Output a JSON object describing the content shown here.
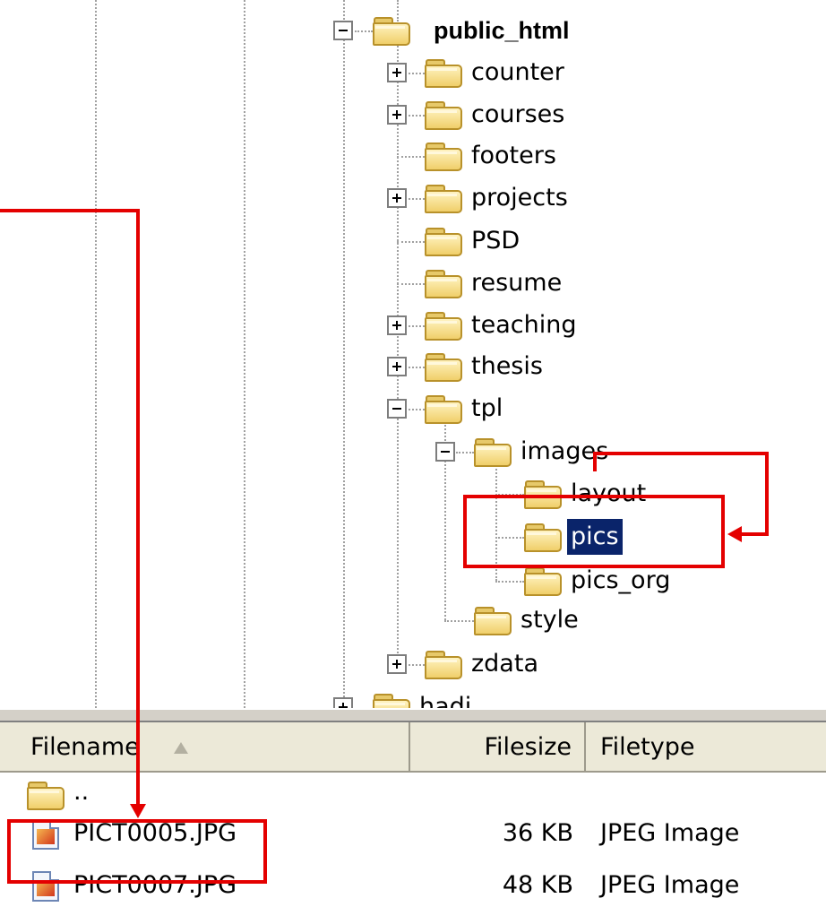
{
  "tree": {
    "nodes": [
      {
        "id": "public_html",
        "label": "public_html",
        "toggle": "minus"
      },
      {
        "id": "counter",
        "label": "counter",
        "toggle": "plus"
      },
      {
        "id": "courses",
        "label": "courses",
        "toggle": "plus"
      },
      {
        "id": "footers",
        "label": "footers",
        "toggle": "none"
      },
      {
        "id": "projects",
        "label": "projects",
        "toggle": "plus"
      },
      {
        "id": "psd",
        "label": "PSD",
        "toggle": "none"
      },
      {
        "id": "resume",
        "label": "resume",
        "toggle": "none"
      },
      {
        "id": "teaching",
        "label": "teaching",
        "toggle": "plus"
      },
      {
        "id": "thesis",
        "label": "thesis",
        "toggle": "plus"
      },
      {
        "id": "tpl",
        "label": "tpl",
        "toggle": "minus"
      },
      {
        "id": "images",
        "label": "images",
        "toggle": "minus"
      },
      {
        "id": "layout",
        "label": "layout",
        "toggle": "none"
      },
      {
        "id": "pics",
        "label": "pics",
        "toggle": "none",
        "selected": true
      },
      {
        "id": "pics_org",
        "label": "pics_org",
        "toggle": "none"
      },
      {
        "id": "style",
        "label": "style",
        "toggle": "none"
      },
      {
        "id": "zdata",
        "label": "zdata",
        "toggle": "plus"
      },
      {
        "id": "hadi",
        "label": "hadi",
        "toggle": "plus"
      }
    ]
  },
  "file_list": {
    "columns": {
      "filename": "Filename",
      "filesize": "Filesize",
      "filetype": "Filetype"
    },
    "sort_icon": "sort-ascending-icon",
    "parent_dir": "..",
    "rows": [
      {
        "name": "PICT0005.JPG",
        "size": "36 KB",
        "type": "JPEG Image"
      },
      {
        "name": "PICT0007.JPG",
        "size": "48 KB",
        "type": "JPEG Image"
      }
    ]
  },
  "colors": {
    "annotation_red": "#e40000",
    "selection_bg": "#0a246a",
    "header_bg": "#ece9d8"
  }
}
